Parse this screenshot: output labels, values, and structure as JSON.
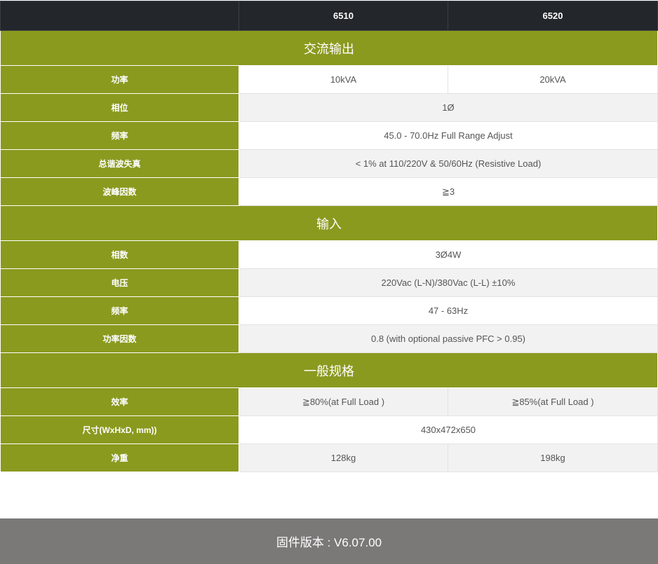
{
  "header": {
    "model_a": "6510",
    "model_b": "6520"
  },
  "sections": [
    {
      "title": "交流输出",
      "rows": [
        {
          "label": "功率",
          "a": "10kVA",
          "b": "20kVA"
        },
        {
          "label": "相位",
          "merged": "1Ø"
        },
        {
          "label": "频率",
          "merged": "45.0 - 70.0Hz Full Range Adjust"
        },
        {
          "label": "总谐波失真",
          "merged": "< 1% at 110/220V & 50/60Hz (Resistive Load)"
        },
        {
          "label": "波峰因数",
          "merged": "≧3"
        }
      ]
    },
    {
      "title": "输入",
      "rows": [
        {
          "label": "相数",
          "merged": "3Ø4W"
        },
        {
          "label": "电压",
          "merged": "220Vac (L-N)/380Vac (L-L) ±10%"
        },
        {
          "label": "频率",
          "merged": "47 - 63Hz"
        },
        {
          "label": "功率因数",
          "merged": "0.8 (with optional passive PFC > 0.95)"
        }
      ]
    },
    {
      "title": "一般规格",
      "rows": [
        {
          "label": "效率",
          "a": "≧80%(at Full Load )",
          "b": "≧85%(at Full Load )"
        },
        {
          "label": "尺寸(WxHxD, mm))",
          "merged": "430x472x650"
        },
        {
          "label": "净重",
          "a": "128kg",
          "b": "198kg"
        }
      ]
    }
  ],
  "footer": {
    "firmware": "固件版本 : V6.07.00"
  }
}
